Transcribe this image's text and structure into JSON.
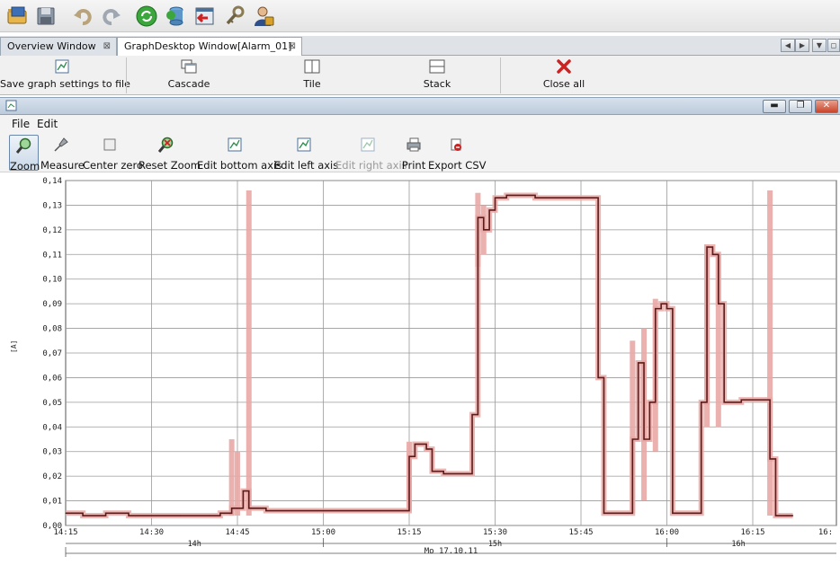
{
  "app_toolbar": {
    "icons": [
      "open-folder-icon",
      "save-disk-icon",
      "undo-icon",
      "redo-icon",
      "refresh-green-icon",
      "database-sync-icon",
      "import-window-icon",
      "tools-key-icon",
      "user-settings-icon"
    ]
  },
  "tabs": [
    {
      "label": "Overview Window",
      "close": "⊠",
      "active": false
    },
    {
      "label": "GraphDesktop Window[Alarm_01]",
      "close": "⊠",
      "active": true
    }
  ],
  "tab_nav": {
    "prev": "◀",
    "next": "▶",
    "menu": "▼",
    "restore": "◻"
  },
  "actions": {
    "save_graph": "Save graph settings to file",
    "cascade": "Cascade",
    "tile": "Tile",
    "stack": "Stack",
    "close_all": "Close all"
  },
  "inner_window": {
    "minimize": "▬",
    "restore": "❐",
    "close": "✕"
  },
  "menu": {
    "file": "File",
    "edit": "Edit"
  },
  "graph_toolbar": {
    "zoom": "Zoom",
    "measure": "Measure",
    "center_zero": "Center zero",
    "reset_zoom": "Reset Zoom",
    "edit_bottom_axis": "Edit bottom axis",
    "edit_left_axis": "Edit left axis",
    "edit_right_axis": "Edit right axis",
    "print": "Print",
    "export_csv": "Export CSV"
  },
  "colors": {
    "line": "#5c1a1a",
    "band": "#e9a9a6",
    "grid": "#9a9a9a",
    "close_all_x": "#cc2222"
  },
  "chart_data": {
    "type": "line",
    "ylabel": "[A]",
    "ylim": [
      0,
      0.14
    ],
    "y_ticks": [
      "0,00",
      "0,01",
      "0,02",
      "0,03",
      "0,04",
      "0,05",
      "0,06",
      "0,07",
      "0,08",
      "0,09",
      "0,10",
      "0,11",
      "0,12",
      "0,13",
      "0,14"
    ],
    "x_ticks": [
      "14:15",
      "14:30",
      "14:45",
      "15:00",
      "15:15",
      "15:30",
      "15:45",
      "16:00",
      "16:15",
      "16:"
    ],
    "hour_labels": [
      "14h",
      "15h",
      "16h"
    ],
    "date_label": "Mo 17.10.11",
    "grid": true,
    "series": [
      {
        "values": [
          {
            "t": "14:15",
            "v": 0.005
          },
          {
            "t": "14:18",
            "v": 0.004
          },
          {
            "t": "14:22",
            "v": 0.005
          },
          {
            "t": "14:26",
            "v": 0.004
          },
          {
            "t": "14:30",
            "v": 0.004
          },
          {
            "t": "14:35",
            "v": 0.004
          },
          {
            "t": "14:40",
            "v": 0.004
          },
          {
            "t": "14:42",
            "v": 0.005
          },
          {
            "t": "14:44",
            "v": 0.007
          },
          {
            "t": "14:46",
            "v": 0.014
          },
          {
            "t": "14:47",
            "v": 0.007
          },
          {
            "t": "14:50",
            "v": 0.006
          },
          {
            "t": "14:55",
            "v": 0.006
          },
          {
            "t": "15:00",
            "v": 0.006
          },
          {
            "t": "15:05",
            "v": 0.006
          },
          {
            "t": "15:10",
            "v": 0.006
          },
          {
            "t": "15:13",
            "v": 0.006
          },
          {
            "t": "15:15",
            "v": 0.028
          },
          {
            "t": "15:16",
            "v": 0.033
          },
          {
            "t": "15:18",
            "v": 0.031
          },
          {
            "t": "15:19",
            "v": 0.022
          },
          {
            "t": "15:21",
            "v": 0.021
          },
          {
            "t": "15:25",
            "v": 0.021
          },
          {
            "t": "15:26",
            "v": 0.045
          },
          {
            "t": "15:27",
            "v": 0.125
          },
          {
            "t": "15:28",
            "v": 0.12
          },
          {
            "t": "15:29",
            "v": 0.128
          },
          {
            "t": "15:30",
            "v": 0.133
          },
          {
            "t": "15:32",
            "v": 0.134
          },
          {
            "t": "15:37",
            "v": 0.133
          },
          {
            "t": "15:42",
            "v": 0.133
          },
          {
            "t": "15:47",
            "v": 0.133
          },
          {
            "t": "15:48",
            "v": 0.06
          },
          {
            "t": "15:49",
            "v": 0.005
          },
          {
            "t": "15:53",
            "v": 0.005
          },
          {
            "t": "15:54",
            "v": 0.035
          },
          {
            "t": "15:55",
            "v": 0.066
          },
          {
            "t": "15:56",
            "v": 0.035
          },
          {
            "t": "15:57",
            "v": 0.05
          },
          {
            "t": "15:58",
            "v": 0.088
          },
          {
            "t": "15:59",
            "v": 0.09
          },
          {
            "t": "16:00",
            "v": 0.088
          },
          {
            "t": "16:01",
            "v": 0.005
          },
          {
            "t": "16:05",
            "v": 0.005
          },
          {
            "t": "16:06",
            "v": 0.05
          },
          {
            "t": "16:07",
            "v": 0.113
          },
          {
            "t": "16:08",
            "v": 0.11
          },
          {
            "t": "16:09",
            "v": 0.09
          },
          {
            "t": "16:10",
            "v": 0.05
          },
          {
            "t": "16:13",
            "v": 0.051
          },
          {
            "t": "16:17",
            "v": 0.051
          },
          {
            "t": "16:18",
            "v": 0.027
          },
          {
            "t": "16:19",
            "v": 0.004
          },
          {
            "t": "16:21",
            "v": 0.004
          },
          {
            "t": "16:22",
            "v": 0.004
          }
        ],
        "band": [
          {
            "t": "14:44",
            "lo": 0.004,
            "hi": 0.035
          },
          {
            "t": "14:45",
            "lo": 0.004,
            "hi": 0.03
          },
          {
            "t": "14:47",
            "lo": 0.004,
            "hi": 0.136
          },
          {
            "t": "15:15",
            "lo": 0.006,
            "hi": 0.034
          },
          {
            "t": "15:27",
            "lo": 0.105,
            "hi": 0.135
          },
          {
            "t": "15:28",
            "lo": 0.11,
            "hi": 0.13
          },
          {
            "t": "15:54",
            "lo": 0.005,
            "hi": 0.075
          },
          {
            "t": "15:56",
            "lo": 0.01,
            "hi": 0.08
          },
          {
            "t": "15:58",
            "lo": 0.03,
            "hi": 0.092
          },
          {
            "t": "16:07",
            "lo": 0.04,
            "hi": 0.114
          },
          {
            "t": "16:09",
            "lo": 0.04,
            "hi": 0.11
          },
          {
            "t": "16:18",
            "lo": 0.004,
            "hi": 0.136
          }
        ]
      }
    ]
  }
}
